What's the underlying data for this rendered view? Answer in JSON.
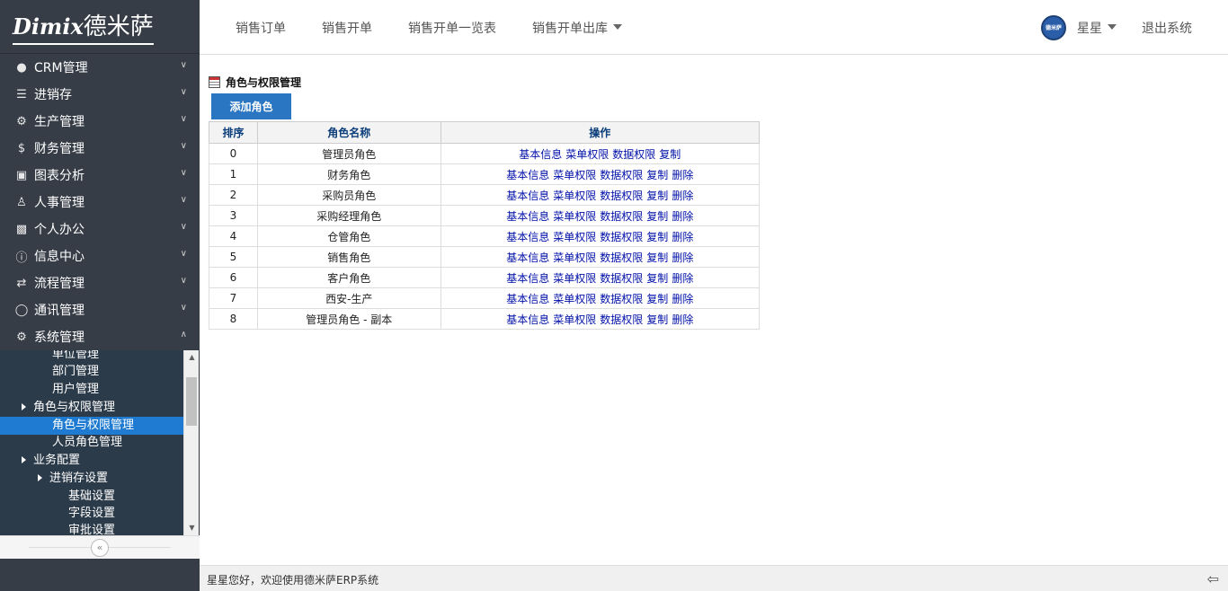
{
  "logo": {
    "latin": "Dimix",
    "cn": "德米萨"
  },
  "sidebar": {
    "items": [
      {
        "label": "CRM管理",
        "icon": "user-icon"
      },
      {
        "label": "进销存",
        "icon": "list-icon"
      },
      {
        "label": "生产管理",
        "icon": "gears-icon"
      },
      {
        "label": "财务管理",
        "icon": "dollar-icon"
      },
      {
        "label": "图表分析",
        "icon": "picture-icon"
      },
      {
        "label": "人事管理",
        "icon": "person-icon"
      },
      {
        "label": "个人办公",
        "icon": "briefcase-icon"
      },
      {
        "label": "信息中心",
        "icon": "info-icon"
      },
      {
        "label": "流程管理",
        "icon": "exchange-icon"
      },
      {
        "label": "通讯管理",
        "icon": "chat-icon"
      },
      {
        "label": "系统管理",
        "icon": "gear-icon"
      }
    ],
    "submenu": [
      {
        "label": "单位管理"
      },
      {
        "label": "部门管理"
      },
      {
        "label": "用户管理"
      },
      {
        "label": "角色与权限管理"
      },
      {
        "label": "角色与权限管理"
      },
      {
        "label": "人员角色管理"
      },
      {
        "label": "业务配置"
      },
      {
        "label": "进销存设置"
      },
      {
        "label": "基础设置"
      },
      {
        "label": "字段设置"
      },
      {
        "label": "审批设置"
      }
    ],
    "collapse_glyph": "«"
  },
  "header": {
    "nav": [
      "销售订单",
      "销售开单",
      "销售开单一览表",
      "销售开单出库"
    ],
    "user": "星星",
    "logout": "退出系统",
    "avatar_text": "德米萨"
  },
  "panel": {
    "title": "角色与权限管理",
    "add_button": "添加角色"
  },
  "table": {
    "headers": [
      "排序",
      "角色名称",
      "操作"
    ],
    "ops_full": [
      "基本信息",
      "菜单权限",
      "数据权限",
      "复制",
      "删除"
    ],
    "rows": [
      {
        "order": "0",
        "name": "管理员角色"
      },
      {
        "order": "1",
        "name": "财务角色"
      },
      {
        "order": "2",
        "name": "采购员角色"
      },
      {
        "order": "3",
        "name": "采购经理角色"
      },
      {
        "order": "4",
        "name": "仓管角色"
      },
      {
        "order": "5",
        "name": "销售角色"
      },
      {
        "order": "6",
        "name": "客户角色"
      },
      {
        "order": "7",
        "name": "西安-生产"
      },
      {
        "order": "8",
        "name": "管理员角色 - 副本"
      }
    ]
  },
  "footer": {
    "text": "星星您好，欢迎使用德米萨ERP系统"
  }
}
